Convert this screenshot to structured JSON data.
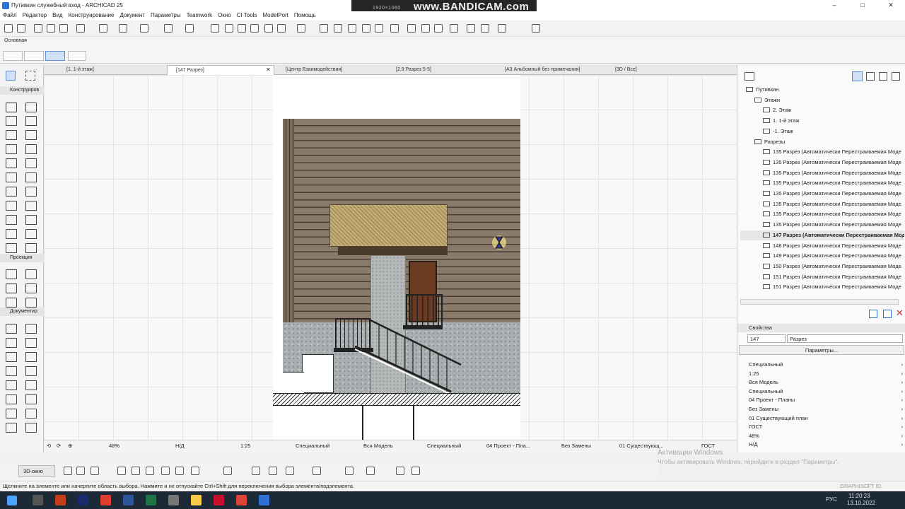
{
  "window": {
    "title": "Путивкин служебный вход - ARCHICAD 25",
    "min": "–",
    "max": "□",
    "close": "✕"
  },
  "overlay": {
    "bandicam": "www.BANDICAM.com",
    "resolution": "1920×1080"
  },
  "menu": [
    "Файл",
    "Редактор",
    "Вид",
    "Конструирование",
    "Документ",
    "Параметры",
    "Teamwork",
    "Окно",
    "CI Tools",
    "ModelPort",
    "Помощь"
  ],
  "infobox": {
    "label": "Основная"
  },
  "toolbox": {
    "sections": [
      "Конструиров",
      "Проекция",
      "Документир"
    ]
  },
  "tabs": [
    "[1. 1-й этаж]",
    "[147 Разрез]",
    "[Центр Взаимодействия]",
    "[2.9 Разрез 5-5]",
    "[А3 Альбомный без примечания]",
    "[3D / Все]"
  ],
  "bottombar": {
    "zoom": "48%",
    "angle": "Н/Д",
    "scale": "1:25",
    "layer": "Специальный",
    "model": "Вся Модель",
    "pen": "Специальный",
    "mvo": "04 Проект - Пла...",
    "override": "Без Замены",
    "reno": "01 Существующ...",
    "dim": "ГОСТ"
  },
  "toolbar2": {
    "view3d": "3D-окно"
  },
  "status": "Щелкните на элементе или начертите область выбора. Нажмите и не отпускайте Ctrl+Shift для переключения выбора элемента/подэлемента.",
  "navigator": {
    "rows": [
      {
        "label": "Путивкин",
        "level": 0
      },
      {
        "label": "Этажи",
        "level": 1
      },
      {
        "label": "2. Этаж",
        "level": 2
      },
      {
        "label": "1. 1-й этаж",
        "level": 2
      },
      {
        "label": "-1. Этаж",
        "level": 2
      },
      {
        "label": "Разрезы",
        "level": 1
      },
      {
        "label": "135 Разрез (Автоматически Перестраиваемая Моде",
        "level": 2
      },
      {
        "label": "135 Разрез (Автоматически Перестраиваемая Моде",
        "level": 2
      },
      {
        "label": "135 Разрез (Автоматически Перестраиваемая Моде",
        "level": 2
      },
      {
        "label": "135 Разрез (Автоматически Перестраиваемая Моде",
        "level": 2
      },
      {
        "label": "135 Разрез (Автоматически Перестраиваемая Моде",
        "level": 2
      },
      {
        "label": "135 Разрез (Автоматически Перестраиваемая Моде",
        "level": 2
      },
      {
        "label": "135 Разрез (Автоматически Перестраиваемая Моде",
        "level": 2
      },
      {
        "label": "135 Разрез (Автоматически Перестраиваемая Моде",
        "level": 2
      },
      {
        "label": "147 Разрез (Автоматически Перестраиваемая Мод",
        "level": 2,
        "selected": true
      },
      {
        "label": "148 Разрез (Автоматически Перестраиваемая Моде",
        "level": 2
      },
      {
        "label": "149 Разрез (Автоматически Перестраиваемая Моде",
        "level": 2
      },
      {
        "label": "150 Разрез (Автоматически Перестраиваемая Моде",
        "level": 2
      },
      {
        "label": "151 Разрез (Автоматически Перестраиваемая Моде",
        "level": 2
      },
      {
        "label": "151 Разрез (Автоматически Перестраиваемая Моде",
        "level": 2
      }
    ]
  },
  "properties": {
    "header": "Свойства",
    "id": "147",
    "name": "Разрез",
    "button": "Параметры...",
    "rows": [
      "Специальный",
      "1:25",
      "Вся Модель",
      "Специальный",
      "04 Проект - Планы",
      "Без Замены",
      "01 Существующий план",
      "ГОСТ",
      "48%",
      "Н/Д"
    ]
  },
  "activation": {
    "line1": "Активация Windows",
    "line2": "Чтобы активировать Windows, перейдите в раздел \"Параметры\"."
  },
  "graphisoft": "GRAPHISOFT ID",
  "tray": {
    "lang": "РУС",
    "time": "11:20:23",
    "date": "13.10.2022"
  },
  "colors": {
    "wood": "#8a7a6a",
    "door": "#6b3a22",
    "taskbar": "#1c2a38",
    "accent": "#2f6fd6"
  }
}
